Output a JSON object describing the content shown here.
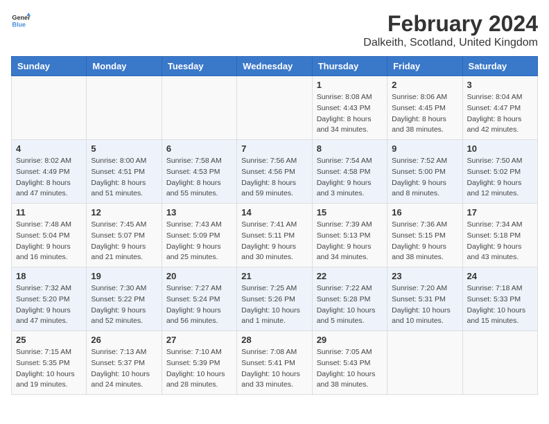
{
  "logo": {
    "line1": "General",
    "line2": "Blue"
  },
  "title": "February 2024",
  "subtitle": "Dalkeith, Scotland, United Kingdom",
  "days_of_week": [
    "Sunday",
    "Monday",
    "Tuesday",
    "Wednesday",
    "Thursday",
    "Friday",
    "Saturday"
  ],
  "weeks": [
    [
      {
        "day": "",
        "info": ""
      },
      {
        "day": "",
        "info": ""
      },
      {
        "day": "",
        "info": ""
      },
      {
        "day": "",
        "info": ""
      },
      {
        "day": "1",
        "info": "Sunrise: 8:08 AM\nSunset: 4:43 PM\nDaylight: 8 hours\nand 34 minutes."
      },
      {
        "day": "2",
        "info": "Sunrise: 8:06 AM\nSunset: 4:45 PM\nDaylight: 8 hours\nand 38 minutes."
      },
      {
        "day": "3",
        "info": "Sunrise: 8:04 AM\nSunset: 4:47 PM\nDaylight: 8 hours\nand 42 minutes."
      }
    ],
    [
      {
        "day": "4",
        "info": "Sunrise: 8:02 AM\nSunset: 4:49 PM\nDaylight: 8 hours\nand 47 minutes."
      },
      {
        "day": "5",
        "info": "Sunrise: 8:00 AM\nSunset: 4:51 PM\nDaylight: 8 hours\nand 51 minutes."
      },
      {
        "day": "6",
        "info": "Sunrise: 7:58 AM\nSunset: 4:53 PM\nDaylight: 8 hours\nand 55 minutes."
      },
      {
        "day": "7",
        "info": "Sunrise: 7:56 AM\nSunset: 4:56 PM\nDaylight: 8 hours\nand 59 minutes."
      },
      {
        "day": "8",
        "info": "Sunrise: 7:54 AM\nSunset: 4:58 PM\nDaylight: 9 hours\nand 3 minutes."
      },
      {
        "day": "9",
        "info": "Sunrise: 7:52 AM\nSunset: 5:00 PM\nDaylight: 9 hours\nand 8 minutes."
      },
      {
        "day": "10",
        "info": "Sunrise: 7:50 AM\nSunset: 5:02 PM\nDaylight: 9 hours\nand 12 minutes."
      }
    ],
    [
      {
        "day": "11",
        "info": "Sunrise: 7:48 AM\nSunset: 5:04 PM\nDaylight: 9 hours\nand 16 minutes."
      },
      {
        "day": "12",
        "info": "Sunrise: 7:45 AM\nSunset: 5:07 PM\nDaylight: 9 hours\nand 21 minutes."
      },
      {
        "day": "13",
        "info": "Sunrise: 7:43 AM\nSunset: 5:09 PM\nDaylight: 9 hours\nand 25 minutes."
      },
      {
        "day": "14",
        "info": "Sunrise: 7:41 AM\nSunset: 5:11 PM\nDaylight: 9 hours\nand 30 minutes."
      },
      {
        "day": "15",
        "info": "Sunrise: 7:39 AM\nSunset: 5:13 PM\nDaylight: 9 hours\nand 34 minutes."
      },
      {
        "day": "16",
        "info": "Sunrise: 7:36 AM\nSunset: 5:15 PM\nDaylight: 9 hours\nand 38 minutes."
      },
      {
        "day": "17",
        "info": "Sunrise: 7:34 AM\nSunset: 5:18 PM\nDaylight: 9 hours\nand 43 minutes."
      }
    ],
    [
      {
        "day": "18",
        "info": "Sunrise: 7:32 AM\nSunset: 5:20 PM\nDaylight: 9 hours\nand 47 minutes."
      },
      {
        "day": "19",
        "info": "Sunrise: 7:30 AM\nSunset: 5:22 PM\nDaylight: 9 hours\nand 52 minutes."
      },
      {
        "day": "20",
        "info": "Sunrise: 7:27 AM\nSunset: 5:24 PM\nDaylight: 9 hours\nand 56 minutes."
      },
      {
        "day": "21",
        "info": "Sunrise: 7:25 AM\nSunset: 5:26 PM\nDaylight: 10 hours\nand 1 minute."
      },
      {
        "day": "22",
        "info": "Sunrise: 7:22 AM\nSunset: 5:28 PM\nDaylight: 10 hours\nand 5 minutes."
      },
      {
        "day": "23",
        "info": "Sunrise: 7:20 AM\nSunset: 5:31 PM\nDaylight: 10 hours\nand 10 minutes."
      },
      {
        "day": "24",
        "info": "Sunrise: 7:18 AM\nSunset: 5:33 PM\nDaylight: 10 hours\nand 15 minutes."
      }
    ],
    [
      {
        "day": "25",
        "info": "Sunrise: 7:15 AM\nSunset: 5:35 PM\nDaylight: 10 hours\nand 19 minutes."
      },
      {
        "day": "26",
        "info": "Sunrise: 7:13 AM\nSunset: 5:37 PM\nDaylight: 10 hours\nand 24 minutes."
      },
      {
        "day": "27",
        "info": "Sunrise: 7:10 AM\nSunset: 5:39 PM\nDaylight: 10 hours\nand 28 minutes."
      },
      {
        "day": "28",
        "info": "Sunrise: 7:08 AM\nSunset: 5:41 PM\nDaylight: 10 hours\nand 33 minutes."
      },
      {
        "day": "29",
        "info": "Sunrise: 7:05 AM\nSunset: 5:43 PM\nDaylight: 10 hours\nand 38 minutes."
      },
      {
        "day": "",
        "info": ""
      },
      {
        "day": "",
        "info": ""
      }
    ]
  ]
}
